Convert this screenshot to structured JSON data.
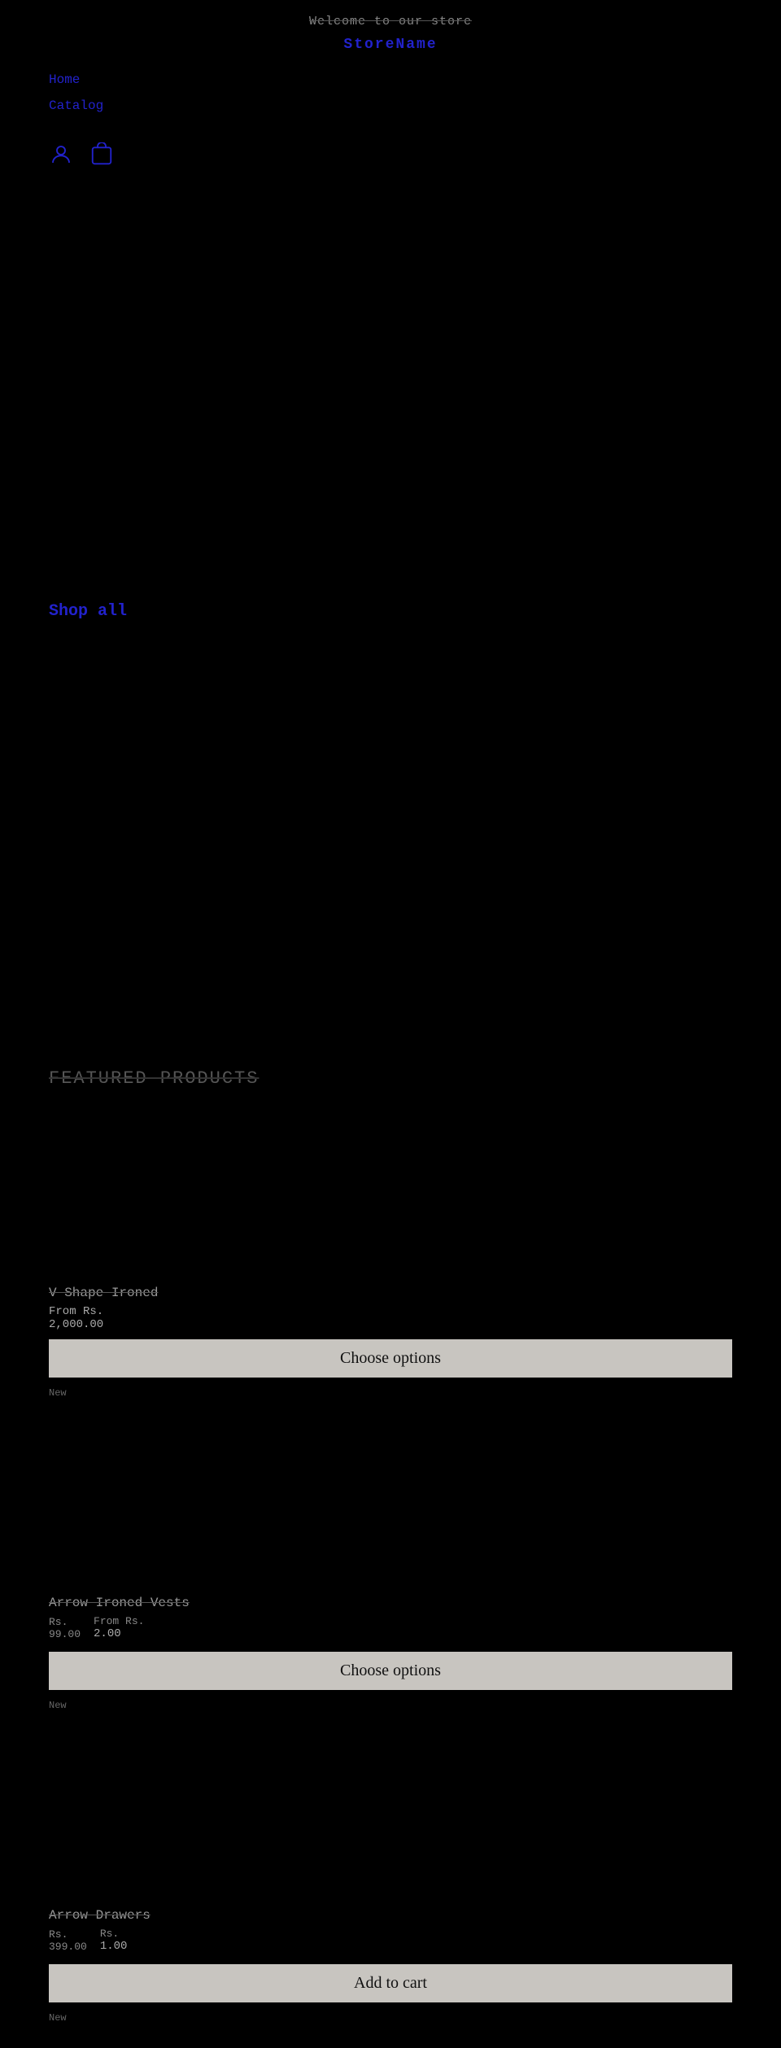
{
  "header": {
    "welcome": "Welcome to our store",
    "store_name": "StoreName"
  },
  "nav": {
    "links": [
      {
        "label": "Home",
        "href": "#"
      },
      {
        "label": "Catalog",
        "href": "#"
      }
    ],
    "icons": [
      {
        "name": "account",
        "symbol": "👤"
      },
      {
        "name": "cart",
        "symbol": "🛍"
      }
    ]
  },
  "hero": {
    "shop_all_label": "Shop all"
  },
  "featured": {
    "section_title": "FEATURED PRODUCTS",
    "products": [
      {
        "name": "V Shape Ironed",
        "price_from_label": "From Rs.",
        "price_from": "2,000.00",
        "btn_label": "Choose options",
        "badge": "New"
      },
      {
        "name": "Arrow Ironed Vests",
        "price_original_label": "Rs.",
        "price_original": "99.00",
        "price_from_label": "From Rs.",
        "price_from": "2.00",
        "btn_label": "Choose options",
        "badge": "New"
      },
      {
        "name": "Arrow Drawers",
        "price_original_label": "Rs.",
        "price_original": "399.00",
        "price_sale_label": "Rs.",
        "price_sale": "1.00",
        "btn_label": "Add to cart",
        "badge": "New"
      }
    ]
  }
}
